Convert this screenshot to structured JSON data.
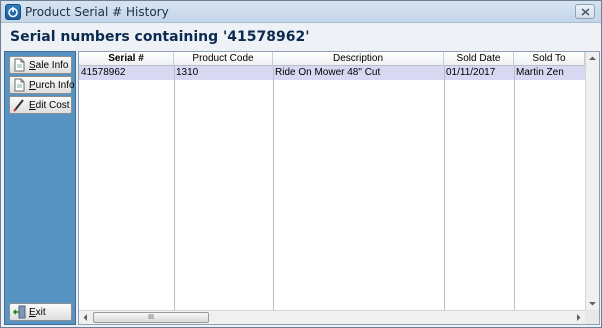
{
  "window": {
    "title": "Product Serial # History",
    "heading": "Serial numbers containing '41578962'"
  },
  "sidebar": {
    "buttons": [
      {
        "label_u": "S",
        "label_rest": "ale Info",
        "icon": "document-icon"
      },
      {
        "label_u": "P",
        "label_rest": "urch Info",
        "icon": "document-icon"
      },
      {
        "label_u": "E",
        "label_rest": "dit Cost",
        "icon": "pencil-icon"
      }
    ],
    "exit": {
      "label_u": "E",
      "label_rest": "xit",
      "icon": "exit-door-icon"
    }
  },
  "table": {
    "columns": [
      "Serial #",
      "Product Code",
      "Description",
      "Sold Date",
      "Sold To"
    ],
    "rows": [
      [
        "41578962",
        "1310",
        "Ride On Mower 48\" Cut",
        "01/11/2017",
        "Martin Zen"
      ]
    ]
  },
  "scrollbar": {
    "thumb_grip": "III"
  }
}
